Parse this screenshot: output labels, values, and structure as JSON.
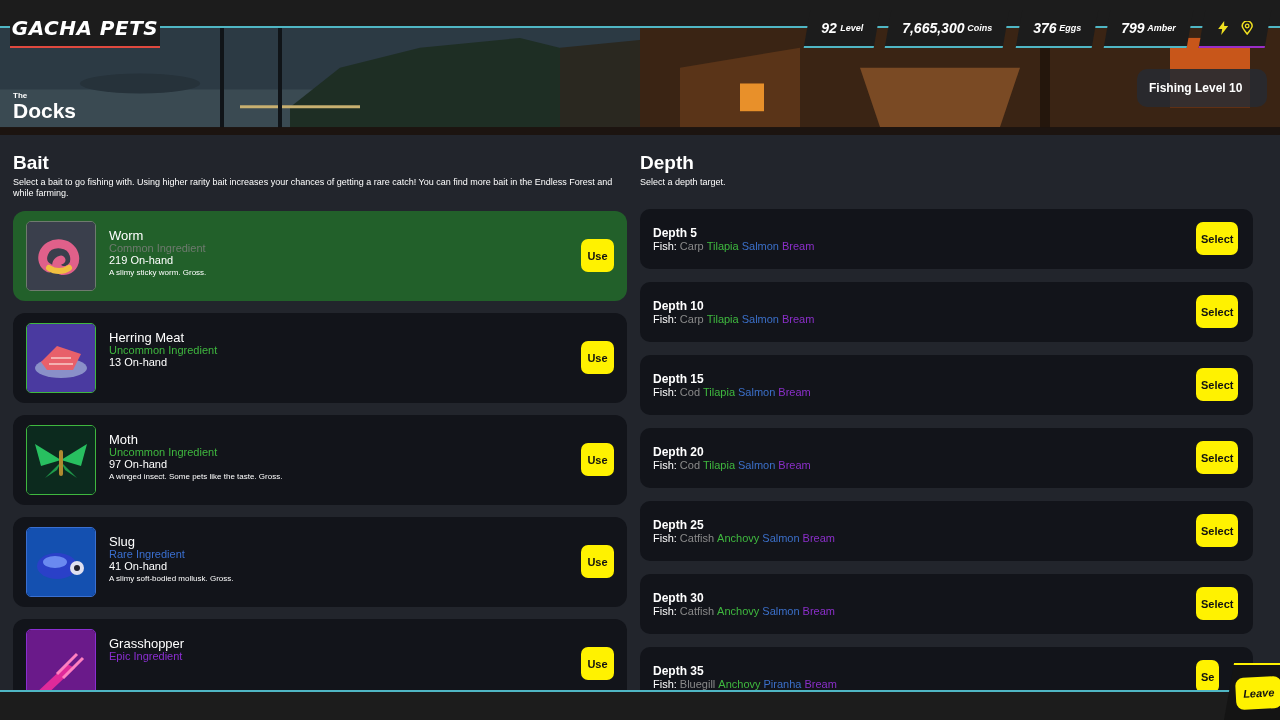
{
  "logo": "GACHA PETS",
  "stats": [
    {
      "value": "92",
      "label": "Level"
    },
    {
      "value": "7,665,300",
      "label": "Coins"
    },
    {
      "value": "376",
      "label": "Eggs"
    },
    {
      "value": "799",
      "label": "Amber"
    }
  ],
  "location": {
    "prefix": "The",
    "name": "Docks"
  },
  "fishing_level": "Fishing Level 10",
  "bait": {
    "title": "Bait",
    "description": "Select a bait to go fishing with. Using higher rarity bait increases your chances of getting a rare catch! You can find more bait in the Endless Forest and while farming.",
    "items": [
      {
        "name": "Worm",
        "rarity": "Common Ingredient",
        "color": "#6f7a6f",
        "on_hand": "219 On-hand",
        "description": "A slimy sticky worm. Gross.",
        "button": "Use",
        "selected": true
      },
      {
        "name": "Herring Meat",
        "rarity": "Uncommon Ingredient",
        "color": "#3fb83f",
        "on_hand": "13 On-hand",
        "button": "Use",
        "selected": false
      },
      {
        "name": "Moth",
        "rarity": "Uncommon Ingredient",
        "color": "#3fb83f",
        "on_hand": "97 On-hand",
        "description": "A winged insect. Some pets like the taste. Gross.",
        "button": "Use",
        "selected": false
      },
      {
        "name": "Slug",
        "rarity": "Rare Ingredient",
        "color": "#3a6fd0",
        "on_hand": "41 On-hand",
        "description": "A slimy soft-bodied mollusk. Gross.",
        "button": "Use",
        "selected": false
      },
      {
        "name": "Grasshopper",
        "rarity": "Epic Ingredient",
        "color": "#8a2ed0",
        "button": "Use",
        "selected": false
      }
    ]
  },
  "depth": {
    "title": "Depth",
    "description": "Select a depth target.",
    "items": [
      {
        "name": "Depth 5",
        "fish_label": "Fish:",
        "fish": [
          {
            "name": "Carp",
            "color": "#8a8a8a"
          },
          {
            "name": "Tilapia",
            "color": "#3fb83f"
          },
          {
            "name": "Salmon",
            "color": "#3b6fc8"
          },
          {
            "name": "Bream",
            "color": "#8a2fc9"
          }
        ],
        "button": "Select"
      },
      {
        "name": "Depth 10",
        "fish_label": "Fish:",
        "fish": [
          {
            "name": "Carp",
            "color": "#8a8a8a"
          },
          {
            "name": "Tilapia",
            "color": "#3fb83f"
          },
          {
            "name": "Salmon",
            "color": "#3b6fc8"
          },
          {
            "name": "Bream",
            "color": "#8a2fc9"
          }
        ],
        "button": "Select"
      },
      {
        "name": "Depth 15",
        "fish_label": "Fish:",
        "fish": [
          {
            "name": "Cod",
            "color": "#8a8a8a"
          },
          {
            "name": "Tilapia",
            "color": "#3fb83f"
          },
          {
            "name": "Salmon",
            "color": "#3b6fc8"
          },
          {
            "name": "Bream",
            "color": "#8a2fc9"
          }
        ],
        "button": "Select"
      },
      {
        "name": "Depth 20",
        "fish_label": "Fish:",
        "fish": [
          {
            "name": "Cod",
            "color": "#8a8a8a"
          },
          {
            "name": "Tilapia",
            "color": "#3fb83f"
          },
          {
            "name": "Salmon",
            "color": "#3b6fc8"
          },
          {
            "name": "Bream",
            "color": "#8a2fc9"
          }
        ],
        "button": "Select"
      },
      {
        "name": "Depth 25",
        "fish_label": "Fish:",
        "fish": [
          {
            "name": "Catfish",
            "color": "#8a8a8a"
          },
          {
            "name": "Anchovy",
            "color": "#3fb83f"
          },
          {
            "name": "Salmon",
            "color": "#3b6fc8"
          },
          {
            "name": "Bream",
            "color": "#8a2fc9"
          }
        ],
        "button": "Select"
      },
      {
        "name": "Depth 30",
        "fish_label": "Fish:",
        "fish": [
          {
            "name": "Catfish",
            "color": "#8a8a8a"
          },
          {
            "name": "Anchovy",
            "color": "#3fb83f"
          },
          {
            "name": "Salmon",
            "color": "#3b6fc8"
          },
          {
            "name": "Bream",
            "color": "#8a2fc9"
          }
        ],
        "button": "Select"
      },
      {
        "name": "Depth 35",
        "fish_label": "Fish:",
        "fish": [
          {
            "name": "Bluegill",
            "color": "#8a8a8a"
          },
          {
            "name": "Anchovy",
            "color": "#3fb83f"
          },
          {
            "name": "Piranha",
            "color": "#3b6fc8"
          },
          {
            "name": "Bream",
            "color": "#8a2fc9"
          }
        ],
        "button": "Se"
      }
    ]
  },
  "leave_button": "Leave"
}
